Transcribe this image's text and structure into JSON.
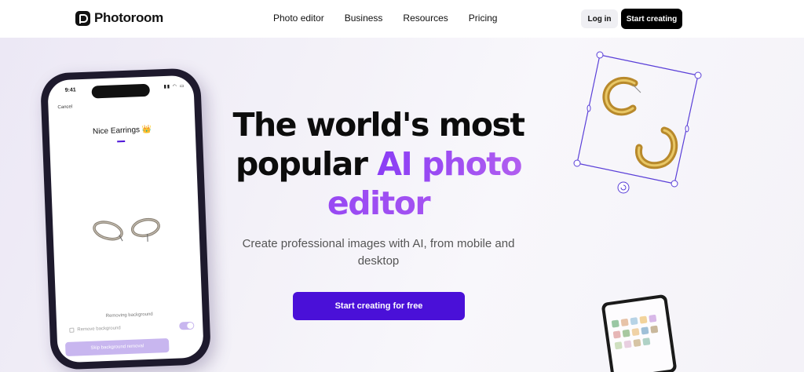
{
  "nav": {
    "logo_text": "Photoroom",
    "links": [
      "Photo editor",
      "Business",
      "Resources",
      "Pricing"
    ],
    "login": "Log in",
    "start": "Start creating"
  },
  "hero": {
    "headline_dark_1": "The world's most",
    "headline_dark_2": "popular",
    "headline_grad_1": "AI photo",
    "headline_grad_2": "editor",
    "subtitle": "Create professional images with AI, from mobile and desktop",
    "cta": "Start creating for free"
  },
  "phone": {
    "time": "9:41",
    "status_icons": "▮▮ ◠ ▭",
    "cancel": "Cancel",
    "title": "Nice Earrings 👑",
    "removing": "Removing background",
    "remove_bg": "Remove background",
    "skip": "Skip background removal"
  },
  "colors": {
    "accent": "#4a10d8",
    "gradient_start": "#8a3df5",
    "gradient_end": "#b15ef0",
    "selection": "#5a3fd8"
  },
  "icons": {
    "rotate": "rotate-icon",
    "logo": "photoroom-logo-icon"
  }
}
